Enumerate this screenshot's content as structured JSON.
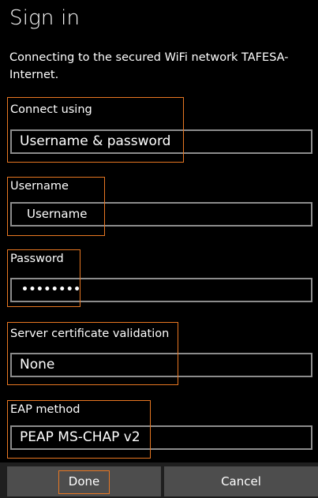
{
  "header": {
    "title": "Sign in",
    "subtitle": "Connecting to the secured WiFi network TAFESA-Internet."
  },
  "form": {
    "connect_using": {
      "label": "Connect using",
      "value": "Username & password"
    },
    "username": {
      "label": "Username",
      "value": "Username"
    },
    "password": {
      "label": "Password",
      "value": "••••••••"
    },
    "server_cert": {
      "label": "Server certificate validation",
      "value": "None"
    },
    "eap_method": {
      "label": "EAP method",
      "value": "PEAP MS-CHAP v2"
    }
  },
  "appbar": {
    "done_label": "Done",
    "cancel_label": "Cancel"
  },
  "colors": {
    "highlight": "#e87722",
    "field_border": "#8c8c8c",
    "appbar_button": "#4d4d4d"
  }
}
